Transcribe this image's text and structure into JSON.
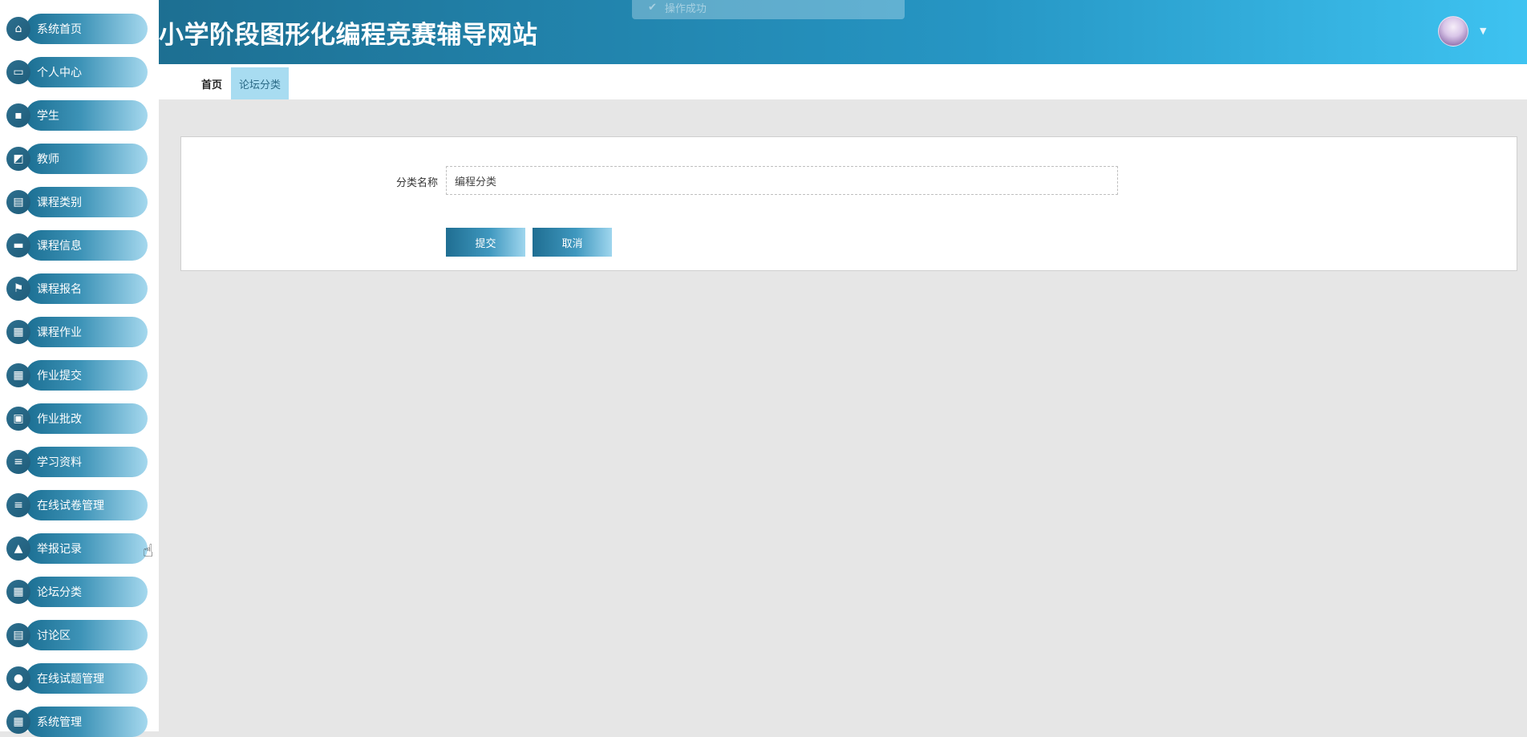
{
  "header": {
    "site_title": "小学阶段图形化编程竞赛辅导网站",
    "toast": "操作成功"
  },
  "sidebar": {
    "items": [
      {
        "label": "系统首页",
        "icon": "home-icon",
        "glyph": "⌂"
      },
      {
        "label": "个人中心",
        "icon": "window-icon",
        "glyph": "▭"
      },
      {
        "label": "学生",
        "icon": "chat-icon",
        "glyph": "▪"
      },
      {
        "label": "教师",
        "icon": "chart-icon",
        "glyph": "◩"
      },
      {
        "label": "课程类别",
        "icon": "clipboard-icon",
        "glyph": "▤"
      },
      {
        "label": "课程信息",
        "icon": "monitor-icon",
        "glyph": "▬"
      },
      {
        "label": "课程报名",
        "icon": "flag-icon",
        "glyph": "⚑"
      },
      {
        "label": "课程作业",
        "icon": "grid-icon",
        "glyph": "▦"
      },
      {
        "label": "作业提交",
        "icon": "grid-icon",
        "glyph": "▦"
      },
      {
        "label": "作业批改",
        "icon": "briefcase-icon",
        "glyph": "▣"
      },
      {
        "label": "学习资料",
        "icon": "list-icon",
        "glyph": "≡"
      },
      {
        "label": "在线试卷管理",
        "icon": "list-icon",
        "glyph": "≡"
      },
      {
        "label": "举报记录",
        "icon": "thumb-icon",
        "glyph": "▲"
      },
      {
        "label": "论坛分类",
        "icon": "grid-icon",
        "glyph": "▦"
      },
      {
        "label": "讨论区",
        "icon": "clipboard-icon",
        "glyph": "▤"
      },
      {
        "label": "在线试题管理",
        "icon": "bulb-icon",
        "glyph": "●"
      },
      {
        "label": "系统管理",
        "icon": "grid-icon",
        "glyph": "▦"
      }
    ]
  },
  "tabs": [
    {
      "label": "首页"
    },
    {
      "label": "论坛分类"
    }
  ],
  "form": {
    "field_label": "分类名称",
    "field_value": "编程分类",
    "submit_label": "提交",
    "cancel_label": "取消"
  }
}
